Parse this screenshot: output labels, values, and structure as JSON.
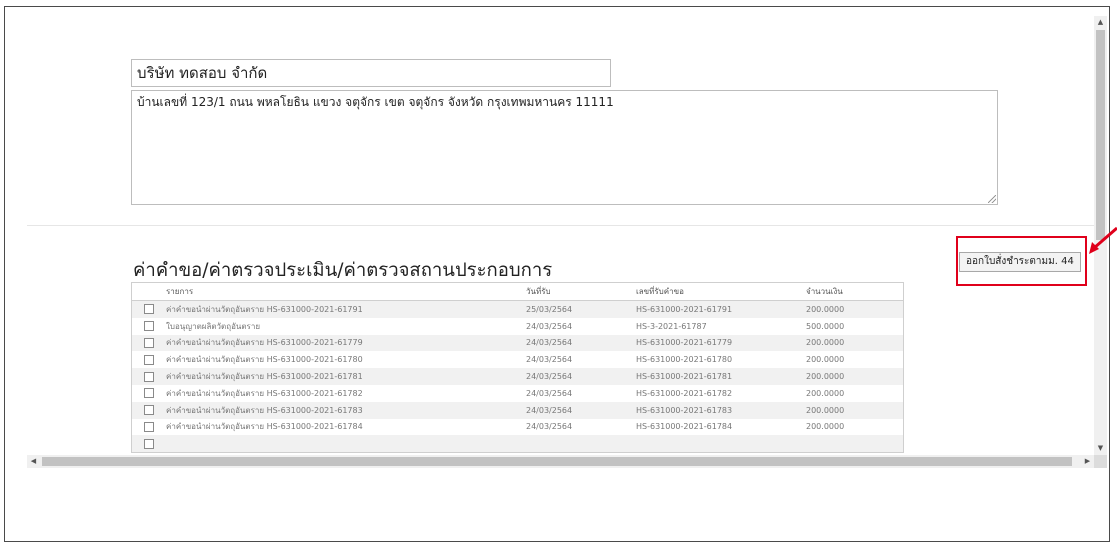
{
  "form": {
    "company_name": "บริษัท ทดสอบ จำกัด",
    "address": "บ้านเลขที่ 123/1 ถนน พหลโยธิน แขวง จตุจักร เขต จตุจักร จังหวัด กรุงเทพมหานคร 11111"
  },
  "section": {
    "title": "ค่าคำขอ/ค่าตรวจประเมิน/ค่าตรวจสถานประกอบการ",
    "issue_button_label": "ออกใบสั่งชำระตามม. 44"
  },
  "table": {
    "columns": [
      "รายการ",
      "วันที่รับ",
      "เลขที่รับคำขอ",
      "จำนวนเงิน"
    ],
    "rows": [
      {
        "item": "ค่าคำขอนำผ่านวัตถุอันตราย HS-631000-2021-61791",
        "date": "25/03/2564",
        "request_no": "HS-631000-2021-61791",
        "amount": "200.0000"
      },
      {
        "item": "ใบอนุญาตผลิตวัตถุอันตราย",
        "date": "24/03/2564",
        "request_no": "HS-3-2021-61787",
        "amount": "500.0000"
      },
      {
        "item": "ค่าคำขอนำผ่านวัตถุอันตราย HS-631000-2021-61779",
        "date": "24/03/2564",
        "request_no": "HS-631000-2021-61779",
        "amount": "200.0000"
      },
      {
        "item": "ค่าคำขอนำผ่านวัตถุอันตราย HS-631000-2021-61780",
        "date": "24/03/2564",
        "request_no": "HS-631000-2021-61780",
        "amount": "200.0000"
      },
      {
        "item": "ค่าคำขอนำผ่านวัตถุอันตราย HS-631000-2021-61781",
        "date": "24/03/2564",
        "request_no": "HS-631000-2021-61781",
        "amount": "200.0000"
      },
      {
        "item": "ค่าคำขอนำผ่านวัตถุอันตราย HS-631000-2021-61782",
        "date": "24/03/2564",
        "request_no": "HS-631000-2021-61782",
        "amount": "200.0000"
      },
      {
        "item": "ค่าคำขอนำผ่านวัตถุอันตราย HS-631000-2021-61783",
        "date": "24/03/2564",
        "request_no": "HS-631000-2021-61783",
        "amount": "200.0000"
      },
      {
        "item": "ค่าคำขอนำผ่านวัตถุอันตราย HS-631000-2021-61784",
        "date": "24/03/2564",
        "request_no": "HS-631000-2021-61784",
        "amount": "200.0000"
      }
    ]
  },
  "colors": {
    "highlight": "#e0001b",
    "row_stripe": "#f1f1f1"
  }
}
